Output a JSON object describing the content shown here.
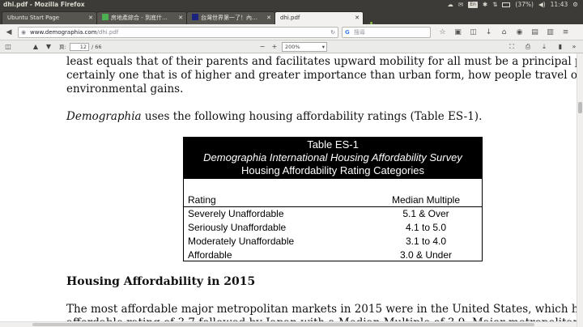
{
  "system": {
    "window_title": "dhi.pdf - Mozilla Firefox",
    "keyboard": "En",
    "battery": "(37%)",
    "time": "11:43"
  },
  "tabs": [
    {
      "label": "Ubuntu Start Page",
      "active": false
    },
    {
      "label": "房地產綜合 - 到底什…",
      "active": false
    },
    {
      "label": "台灣世界第一了！內…",
      "active": false
    },
    {
      "label": "dhi.pdf",
      "active": true
    }
  ],
  "navbar": {
    "url_host": "www.demographia.com",
    "url_path": "/dhi.pdf",
    "search_placeholder": "搜尋"
  },
  "pdf_toolbar": {
    "page_label": "頁:",
    "page_current": "12",
    "page_total": "/ 66",
    "zoom": "200%"
  },
  "document": {
    "para1_line1": "least equals that of their parents and facilitates upward mobility for all must be a principal policy priority –",
    "para1_line2": "certainly one that is of higher and greater importance than urban form, how people travel or miniscule",
    "para1_line3": "environmental gains.",
    "para2_italic": "Demographia",
    "para2_rest": " uses the following housing affordability ratings (Table ES-1).",
    "table": {
      "title1": "Table ES-1",
      "title2": "Demographia International Housing Affordability Survey",
      "title3": "Housing Affordability Rating Categories",
      "col_rating": "Rating",
      "col_multiple": "Median Multiple",
      "rows": [
        {
          "rating": "Severely Unaffordable",
          "multiple": "5.1 & Over"
        },
        {
          "rating": "Seriously Unaffordable",
          "multiple": "4.1 to 5.0"
        },
        {
          "rating": "Moderately Unaffordable",
          "multiple": "3.1 to 4.0"
        },
        {
          "rating": "Affordable",
          "multiple": "3.0 & Under"
        }
      ]
    },
    "heading": "Housing Affordability in 2015",
    "para3_line1": "The most affordable major metropolitan markets in 2015 were in the United States, which had a moderately",
    "para3_line2": "affordable rating of 3.7 followed by Japan with a Median Multiple of 3.9. Major metropolitan markets"
  }
}
